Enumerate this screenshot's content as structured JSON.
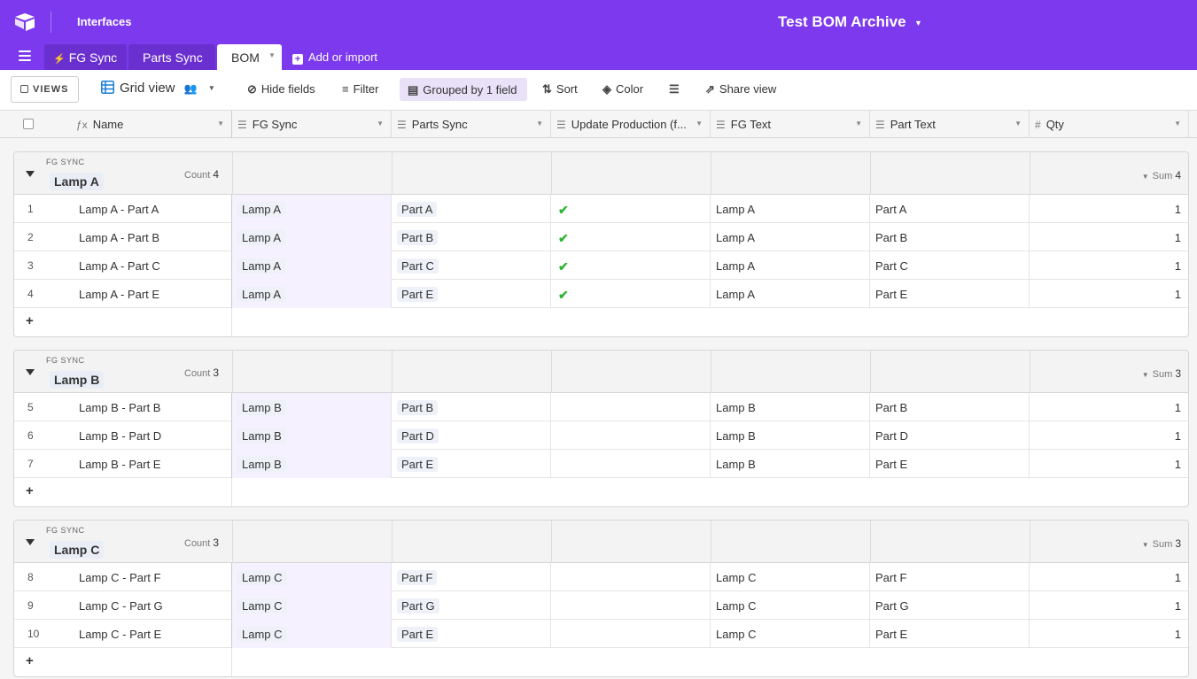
{
  "app": {
    "interfaces_label": "Interfaces",
    "base_name": "Test BOM Archive"
  },
  "tabs": {
    "fg_sync": "FG Sync",
    "parts_sync": "Parts Sync",
    "bom": "BOM",
    "add_or_import": "Add or import"
  },
  "toolbar": {
    "views": "VIEWS",
    "view_name": "Grid view",
    "hide_fields": "Hide fields",
    "filter": "Filter",
    "grouped": "Grouped by 1 field",
    "sort": "Sort",
    "color": "Color",
    "share_view": "Share view"
  },
  "columns": {
    "name": "Name",
    "fg_sync": "FG Sync",
    "parts_sync": "Parts Sync",
    "update_production": "Update Production (f...",
    "fg_text": "FG Text",
    "part_text": "Part Text",
    "qty": "Qty"
  },
  "group_labels": {
    "field": "FG SYNC",
    "count": "Count",
    "sum": "Sum"
  },
  "groups": [
    {
      "value": "Lamp A",
      "count": "4",
      "sum": "4",
      "rows": [
        {
          "num": "1",
          "name": "Lamp A - Part A",
          "fg": "Lamp A",
          "part": "Part A",
          "checked": true,
          "fg_text": "Lamp A",
          "part_text": "Part A",
          "qty": "1"
        },
        {
          "num": "2",
          "name": "Lamp A - Part B",
          "fg": "Lamp A",
          "part": "Part B",
          "checked": true,
          "fg_text": "Lamp A",
          "part_text": "Part B",
          "qty": "1"
        },
        {
          "num": "3",
          "name": "Lamp A - Part C",
          "fg": "Lamp A",
          "part": "Part C",
          "checked": true,
          "fg_text": "Lamp A",
          "part_text": "Part C",
          "qty": "1"
        },
        {
          "num": "4",
          "name": "Lamp A - Part E",
          "fg": "Lamp A",
          "part": "Part E",
          "checked": true,
          "fg_text": "Lamp A",
          "part_text": "Part E",
          "qty": "1"
        }
      ]
    },
    {
      "value": "Lamp B",
      "count": "3",
      "sum": "3",
      "rows": [
        {
          "num": "5",
          "name": "Lamp B - Part B",
          "fg": "Lamp B",
          "part": "Part B",
          "checked": false,
          "fg_text": "Lamp B",
          "part_text": "Part B",
          "qty": "1"
        },
        {
          "num": "6",
          "name": "Lamp B - Part D",
          "fg": "Lamp B",
          "part": "Part D",
          "checked": false,
          "fg_text": "Lamp B",
          "part_text": "Part D",
          "qty": "1"
        },
        {
          "num": "7",
          "name": "Lamp B - Part E",
          "fg": "Lamp B",
          "part": "Part E",
          "checked": false,
          "fg_text": "Lamp B",
          "part_text": "Part E",
          "qty": "1"
        }
      ]
    },
    {
      "value": "Lamp C",
      "count": "3",
      "sum": "3",
      "rows": [
        {
          "num": "8",
          "name": "Lamp C - Part F",
          "fg": "Lamp C",
          "part": "Part F",
          "checked": false,
          "fg_text": "Lamp C",
          "part_text": "Part F",
          "qty": "1"
        },
        {
          "num": "9",
          "name": "Lamp C - Part G",
          "fg": "Lamp C",
          "part": "Part G",
          "checked": false,
          "fg_text": "Lamp C",
          "part_text": "Part G",
          "qty": "1"
        },
        {
          "num": "10",
          "name": "Lamp C - Part E",
          "fg": "Lamp C",
          "part": "Part E",
          "checked": false,
          "fg_text": "Lamp C",
          "part_text": "Part E",
          "qty": "1"
        }
      ]
    }
  ],
  "colors": {
    "brand": "#7c39ed",
    "check": "#2cb531"
  }
}
